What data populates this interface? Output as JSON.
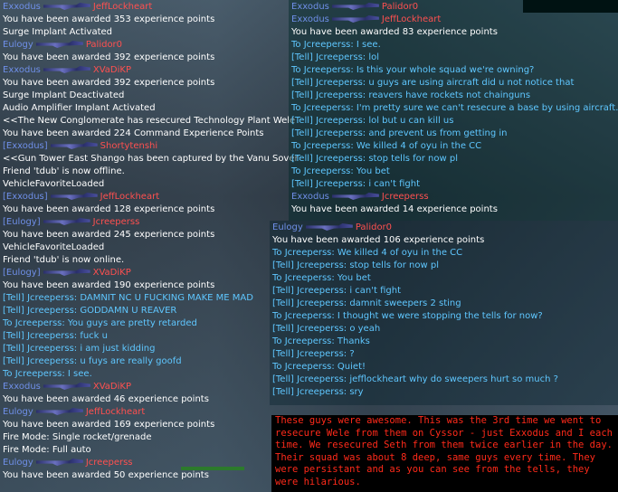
{
  "left_chat": [
    {
      "kind": "award",
      "team": "Exxodus",
      "weapon": "rifle",
      "name": "JeffLockheart"
    },
    {
      "kind": "sys",
      "text": "You have been awarded 353 experience points"
    },
    {
      "kind": "sys",
      "text": "Surge Implant Activated"
    },
    {
      "kind": "award",
      "team": "Eulogy",
      "weapon": "rifle",
      "name": "Palidor0"
    },
    {
      "kind": "sys",
      "text": "You have been awarded 392 experience points"
    },
    {
      "kind": "award",
      "team": "Exxodus",
      "weapon": "rifle",
      "name": "XVaDiKP"
    },
    {
      "kind": "sys",
      "text": "You have been awarded 392 experience points"
    },
    {
      "kind": "sys",
      "text": "Surge Implant Deactivated"
    },
    {
      "kind": "sys",
      "text": "Audio Amplifier Implant Activated"
    },
    {
      "kind": "sys",
      "text": "<<The New Conglomerate has resecured Technology Plant Wele"
    },
    {
      "kind": "sys",
      "text": "You have been awarded 224 Command Experience Points"
    },
    {
      "kind": "award",
      "team": "[Exxodus]",
      "weapon": "rifle",
      "name": "Shortytenshi"
    },
    {
      "kind": "sys",
      "text": "<<Gun Tower East Shango has been captured by the Vanu Sover"
    },
    {
      "kind": "sys",
      "text": "Friend 'tdub' is now offline."
    },
    {
      "kind": "sys",
      "text": "VehicleFavoriteLoaded"
    },
    {
      "kind": "award",
      "team": "[Exxodus]",
      "weapon": "rifle",
      "name": "JeffLockheart"
    },
    {
      "kind": "sys",
      "text": "You have been awarded 128 experience points"
    },
    {
      "kind": "award",
      "team": "[Eulogy]",
      "weapon": "rifle",
      "name": "Jcreeperss"
    },
    {
      "kind": "sys",
      "text": "You have been awarded 245 experience points"
    },
    {
      "kind": "sys",
      "text": "VehicleFavoriteLoaded"
    },
    {
      "kind": "sys",
      "text": "Friend 'tdub' is now online."
    },
    {
      "kind": "award",
      "team": "[Eulogy]",
      "weapon": "rifle",
      "name": "XVaDiKP"
    },
    {
      "kind": "sys",
      "text": "You have been awarded 190 experience points"
    },
    {
      "kind": "tell",
      "text": "[Tell] Jcreeperss: DAMNIT NC U FUCKING MAKE ME MAD"
    },
    {
      "kind": "tell",
      "text": "[Tell] Jcreeperss: GODDAMN U REAVER"
    },
    {
      "kind": "tell",
      "text": "To Jcreeperss: You guys are pretty retarded"
    },
    {
      "kind": "tell",
      "text": "[Tell] Jcreeperss: fuck u"
    },
    {
      "kind": "tell",
      "text": "[Tell] Jcreeperss: i am just kidding"
    },
    {
      "kind": "tell",
      "text": "[Tell] Jcreeperss: u fuys are really goofd"
    },
    {
      "kind": "tell",
      "text": "To Jcreeperss: I see."
    },
    {
      "kind": "award",
      "team": "Exxodus",
      "weapon": "rifle",
      "name": "XVaDiKP"
    },
    {
      "kind": "sys",
      "text": "You have been awarded 46 experience points"
    },
    {
      "kind": "award",
      "team": "Eulogy",
      "weapon": "rifle",
      "name": "JeffLockheart"
    },
    {
      "kind": "sys",
      "text": "You have been awarded 169 experience points"
    },
    {
      "kind": "sys",
      "text": "Fire Mode: Single rocket/grenade"
    },
    {
      "kind": "sys",
      "text": "Fire Mode: Full auto"
    },
    {
      "kind": "award",
      "team": "Eulogy",
      "weapon": "rifle",
      "name": "Jcreeperss"
    },
    {
      "kind": "sys",
      "text": "You have been awarded 50 experience points"
    }
  ],
  "top_right_chat": [
    {
      "kind": "award",
      "team": "Exxodus",
      "weapon": "rifle",
      "name": "Palidor0"
    },
    {
      "kind": "award",
      "team": "Exxodus",
      "weapon": "rifle",
      "name": "JeffLockheart"
    },
    {
      "kind": "sys",
      "text": "You have been awarded 83 experience points"
    },
    {
      "kind": "tell",
      "text": "To Jcreeperss: I see."
    },
    {
      "kind": "tell",
      "text": "[Tell] Jcreeperss: lol"
    },
    {
      "kind": "tell",
      "text": "To Jcreeperss: Is this your whole squad we're owning?"
    },
    {
      "kind": "tell",
      "text": "[Tell] Jcreeperss: u guys are using aircraft did u not notice that"
    },
    {
      "kind": "tell",
      "text": "[Tell] Jcreeperss: reavers have rockets not chainguns"
    },
    {
      "kind": "tell",
      "text": "To Jcreeperss: I'm pretty sure we can't resecure a base by using aircraft."
    },
    {
      "kind": "tell",
      "text": "[Tell] Jcreeperss: lol but u can kill us"
    },
    {
      "kind": "tell",
      "text": "[Tell] Jcreeperss: and prevent us from getting in"
    },
    {
      "kind": "tell",
      "text": "To Jcreeperss: We killed 4 of oyu in the CC"
    },
    {
      "kind": "tell",
      "text": "[Tell] Jcreeperss: stop tells for now pl"
    },
    {
      "kind": "tell",
      "text": "To Jcreeperss: You bet"
    },
    {
      "kind": "tell",
      "text": "[Tell] Jcreeperss: i can't fight"
    },
    {
      "kind": "award",
      "team": "Exxodus",
      "weapon": "rifle",
      "name": "Jcreeperss"
    },
    {
      "kind": "sys",
      "text": "You have been awarded 14 experience points"
    }
  ],
  "mid_right_chat": [
    {
      "kind": "award",
      "team": "Eulogy",
      "weapon": "rifle",
      "name": "Palidor0"
    },
    {
      "kind": "sys",
      "text": "You have been awarded 106 experience points"
    },
    {
      "kind": "tell",
      "text": "To Jcreeperss: We killed 4 of oyu in the CC"
    },
    {
      "kind": "tell",
      "text": "[Tell] Jcreeperss: stop tells for now pl"
    },
    {
      "kind": "tell",
      "text": "To Jcreeperss: You bet"
    },
    {
      "kind": "tell",
      "text": "[Tell] Jcreeperss: i can't fight"
    },
    {
      "kind": "tell",
      "text": "[Tell] Jcreeperss: damnit sweepers 2 sting"
    },
    {
      "kind": "tell",
      "text": "To Jcreeperss: I thought we were stopping the tells for now?"
    },
    {
      "kind": "tell",
      "text": "[Tell] Jcreeperss: o yeah"
    },
    {
      "kind": "tell",
      "text": "To Jcreeperss: Thanks"
    },
    {
      "kind": "tell",
      "text": "[Tell] Jcreeperss: ?"
    },
    {
      "kind": "tell",
      "text": "To Jcreeperss: Quiet!"
    },
    {
      "kind": "tell",
      "text": "[Tell] Jcreeperss: jefflockheart why do sweepers hurt so much ?"
    },
    {
      "kind": "tell",
      "text": "[Tell] Jcreeperss: sry"
    }
  ],
  "note": "These guys were awesome. This was the 3rd time we went to resecure Wele from them on Cyssor - just Exxodus and I each time. We resecured Seth from them twice earlier in the day. Their squad was about 8 deep, same guys every time. They were persistant and as you can see from the tells, they were hilarious.",
  "colors": {
    "team": "#6f8fe8",
    "name": "#ff5050",
    "tell": "#5fc7ff",
    "system": "#ffffff",
    "note": "#ff2a1a"
  }
}
